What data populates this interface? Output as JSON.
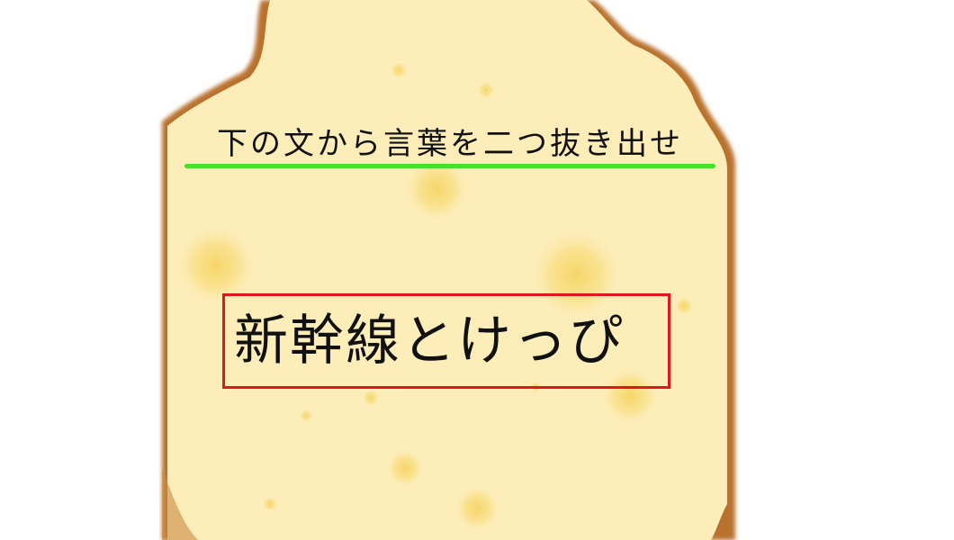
{
  "instruction": "下の文から言葉を二つ抜き出せ",
  "puzzle": {
    "sentence": "新幹線とけっぴ"
  },
  "colors": {
    "cracker_fill": "#fdedb8",
    "cracker_crust": "#b9722f",
    "cracker_spot": "#f7d96e",
    "underline": "#44e02a",
    "box_border": "#e0181c",
    "text": "#111111"
  }
}
